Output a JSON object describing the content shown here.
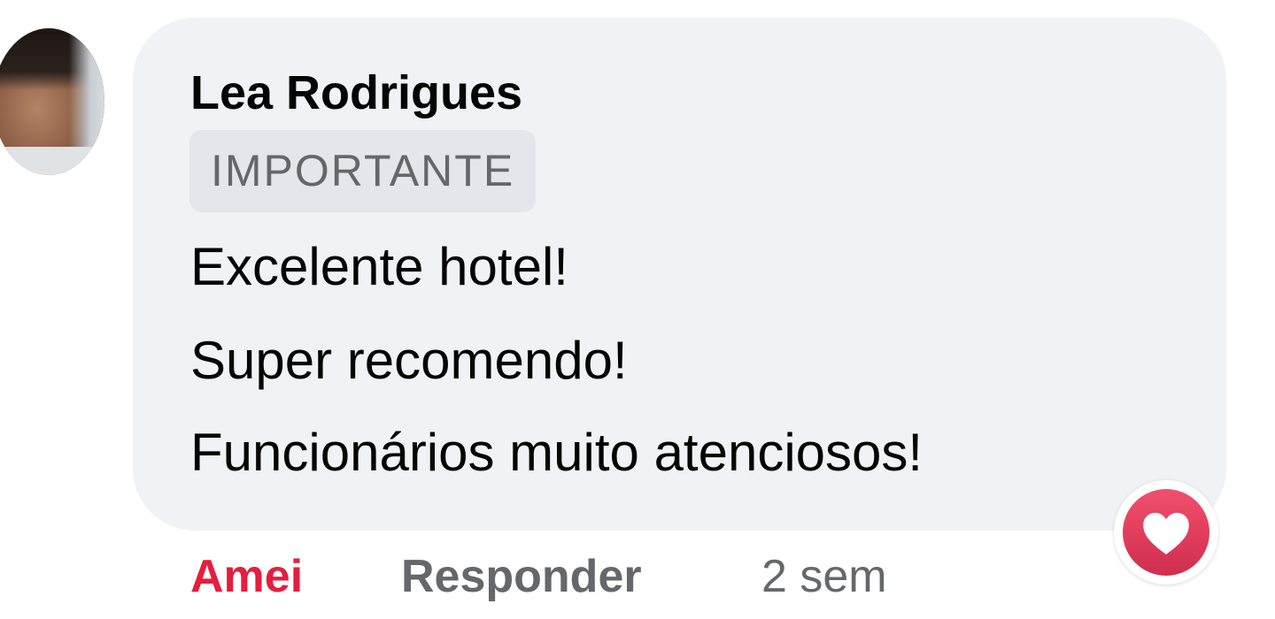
{
  "comment": {
    "author": "Lea Rodrigues",
    "badge": "IMPORTANTE",
    "lines": [
      "Excelente hotel!",
      "Super recomendo!",
      "Funcionários muito atenciosos!"
    ],
    "reaction_icon": "heart-icon",
    "reaction_color": "#e41e3f"
  },
  "actions": {
    "like_label": "Amei",
    "reply_label": "Responder",
    "timestamp": "2 sem"
  },
  "colors": {
    "bubble": "#f0f2f5",
    "badge_bg": "#e4e6eb",
    "secondary_text": "#65676b",
    "love_red": "#e41e3f"
  }
}
